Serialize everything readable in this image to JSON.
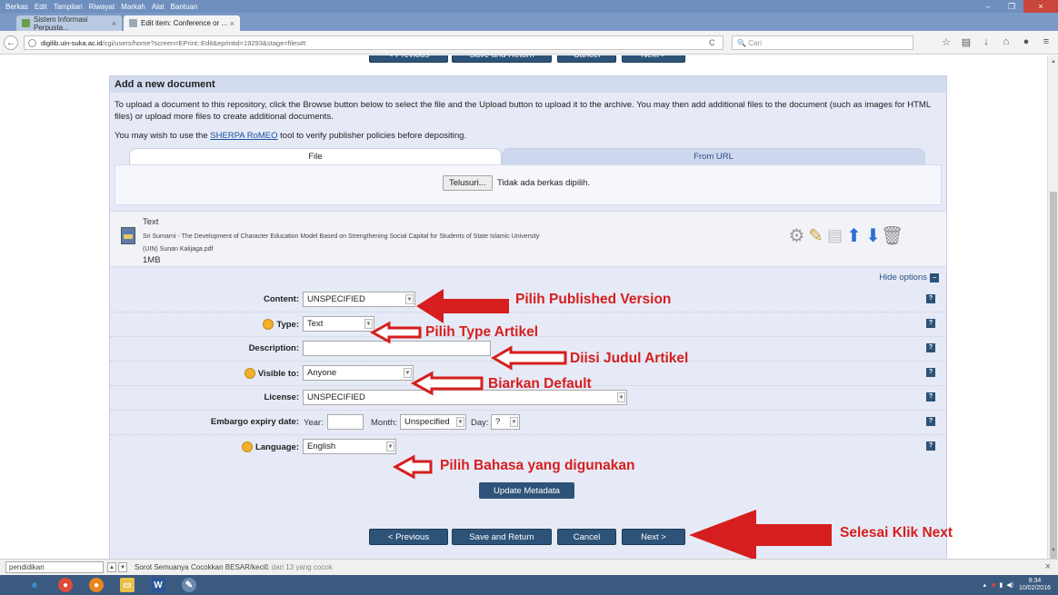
{
  "browser": {
    "menu": [
      "Berkas",
      "Edit",
      "Tampilan",
      "Riwayat",
      "Markah",
      "Alat",
      "Bantuan"
    ],
    "tabs": [
      {
        "title": "Sistem Informasi Perpusta...",
        "close": "×"
      },
      {
        "title": "Edit item: Conference or ...",
        "close": "×"
      }
    ],
    "url_host": "digilib.uin-suka.ac.id",
    "url_path": "/cgi/users/home?screen=EPrint::Edit&eprintid=19293&stage=files#t",
    "search_placeholder": "Cari",
    "win_min": "–",
    "win_max": "❐",
    "win_close": "×"
  },
  "nav": {
    "previous": "< Previous",
    "save_return": "Save and Return",
    "cancel": "Cancel",
    "next": "Next >"
  },
  "panel": {
    "title": "Add a new document",
    "intro": "To upload a document to this repository, click the Browse button below to select the file and the Upload button to upload it to the archive. You may then add additional files to the document (such as images for HTML files) or upload more files to create additional documents.",
    "sherpa_prefix": "You may wish to use the ",
    "sherpa_link": "SHERPA RoMEO",
    "sherpa_suffix": " tool to verify publisher policies before depositing.",
    "tab_file": "File",
    "tab_url": "From URL",
    "browse_label": "Telusuri...",
    "no_file": "Tidak ada berkas dipilih."
  },
  "document": {
    "type": "Text",
    "title_line1": "Sri Sumarni - The Development of Character Education Model Based on Strengthening Social Capital for Students of State Islamic University",
    "title_line2": "(UIN) Sunan Kalijaga.pdf",
    "size": "1MB"
  },
  "options": {
    "hide_label": "Hide options",
    "help": "?",
    "update_label": "Update Metadata"
  },
  "form": {
    "content": {
      "label": "Content:",
      "value": "UNSPECIFIED"
    },
    "type": {
      "label": "Type:",
      "value": "Text"
    },
    "description": {
      "label": "Description:",
      "value": ""
    },
    "visible": {
      "label": "Visible to:",
      "value": "Anyone"
    },
    "license": {
      "label": "License:",
      "value": "UNSPECIFIED"
    },
    "embargo": {
      "label": "Embargo expiry date:",
      "year_label": "Year:",
      "year_value": "",
      "month_label": "Month:",
      "month_value": "Unspecified",
      "day_label": "Day:",
      "day_value": "?"
    },
    "language": {
      "label": "Language:",
      "value": "English"
    }
  },
  "annotations": {
    "content": "Pilih Published Version",
    "type": "Pilih Type Artikel",
    "description": "Diisi Judul Artikel",
    "visible": "Biarkan Default",
    "language": "Pilih Bahasa yang digunakan",
    "next": "Selesai Klik Next",
    "color": "#d61e1e"
  },
  "findbar": {
    "query": "pendidikan",
    "highlight_all": "Sorot Semuanya",
    "match_case": "Cocokkan BESAR/kecil",
    "result": "1 dari 13 yang cocok"
  },
  "taskbar": {
    "time": "9:34",
    "date": "10/02/2016"
  }
}
